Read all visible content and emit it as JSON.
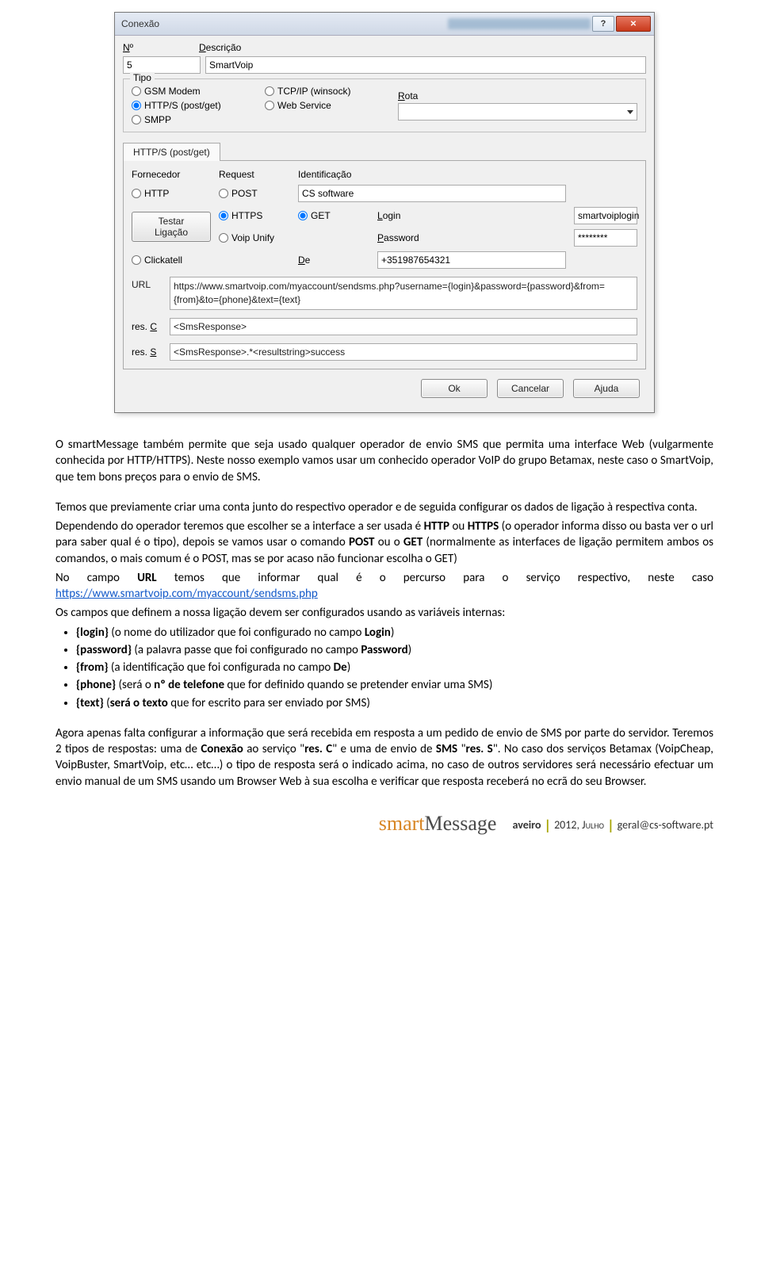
{
  "dialog": {
    "title": "Conexão",
    "header": {
      "num_label_u": "N",
      "num_label_rest": "º",
      "num_value": "5",
      "desc_label_u": "D",
      "desc_label_rest": "escrição",
      "desc_value": "SmartVoip"
    },
    "tipo": {
      "legend_u": "T",
      "legend_rest": "ipo",
      "radios": {
        "gsm": "GSM Modem",
        "https": "HTTP/S (post/get)",
        "smpp": "SMPP",
        "tcpip": "TCP/IP (winsock)",
        "webservice": "Web Service"
      },
      "rota_label_u": "R",
      "rota_label_rest": "ota"
    },
    "tab_label": "HTTP/S (post/get)",
    "http": {
      "fornecedor_label_u": "F",
      "fornecedor_label_rest": "ornecedor",
      "request_label_u": "R",
      "request_label_rest": "equest",
      "identificacao_label_u": "I",
      "identificacao_label_rest": "dentificação",
      "radios": {
        "http": "HTTP",
        "https": "HTTPS",
        "voip": "Voip Unify",
        "click": "Clickatell",
        "post": "POST",
        "get": "GET"
      },
      "ident_value": "CS software",
      "login_label_u": "L",
      "login_label_rest": "ogin",
      "login_value": "smartvoiplogin",
      "password_label_u": "P",
      "password_label_rest": "assword",
      "password_value": "********",
      "de_label_u": "D",
      "de_label_rest": "e",
      "de_value": "+351987654321",
      "test_label": "Testar\nLigação",
      "url_label_u": "U",
      "url_label_rest": "RL",
      "url_value": "https://www.smartvoip.com/myaccount/sendsms.php?username={login}&password={password}&from={from}&to={phone}&text={text}",
      "resc_label": "res. ",
      "resc_label_u": "C",
      "resc_value": "<SmsResponse>",
      "ress_label": "res. ",
      "ress_label_u": "S",
      "ress_value": "<SmsResponse>.*<resultstring>success"
    },
    "buttons": {
      "ok": "Ok",
      "cancel": "Cancelar",
      "help": "Ajuda"
    }
  },
  "doc": {
    "p1": "O smartMessage também permite que seja usado qualquer operador de envio SMS que permita uma interface Web (vulgarmente conhecida por HTTP/HTTPS). Neste nosso exemplo vamos usar um conhecido operador VoIP do grupo Betamax, neste caso o SmartVoip, que tem bons preços para o envio de SMS.",
    "p2": "Temos que previamente criar uma conta junto do respectivo operador e de seguida configurar os dados de ligação à respectiva conta.",
    "p3_a": "Dependendo do operador teremos que escolher se a interface a ser usada é ",
    "p3_b": " ou ",
    "p3_c": " (o operador informa disso ou basta ver o url para saber qual é o tipo), depois se vamos usar o comando ",
    "p3_d": " ou o ",
    "p3_e": " (normalmente as interfaces de ligação permitem ambos os comandos, o mais comum é o POST, mas se por acaso não funcionar escolha o GET)",
    "http": "HTTP",
    "https": "HTTPS",
    "post": "POST",
    "get": "GET",
    "p4_a": "No campo ",
    "url_b": "URL",
    "p4_b": " temos que informar qual é o percurso para o serviço respectivo, neste caso ",
    "url_link": "https://www.smartvoip.com/myaccount/sendsms.php",
    "p5": "Os campos que definem a nossa ligação devem ser configurados usando as variáveis internas:",
    "li1_a": "{login}",
    "li1_b": " (o nome do utilizador que foi configurado no campo ",
    "li1_c": "Login",
    "li1_d": ")",
    "li2_a": "{password}",
    "li2_b": " (a palavra passe que foi configurado no campo ",
    "li2_c": "Password",
    "li2_d": ")",
    "li3_a": "{from}",
    "li3_b": " (a identificação que foi configurada no campo ",
    "li3_c": "De",
    "li3_d": ")",
    "li4_a": "{phone}",
    "li4_b": " (será o ",
    "li4_c": "nº de telefone",
    "li4_d": " que for definido quando se pretender enviar uma SMS)",
    "li5_a": "{text}",
    "li5_b": " (",
    "li5_c": "será o texto",
    "li5_d": " que for escrito para ser enviado por SMS)",
    "p6_a": "Agora apenas falta configurar a informação que será recebida em resposta a um pedido de envio de SMS por parte do servidor. Teremos 2 tipos de respostas: uma de ",
    "p6_b": "Conexão",
    "p6_c": " ao serviço \"",
    "p6_d": "res. C",
    "p6_e": "\" e uma de envio de ",
    "p6_f": "SMS",
    "p6_g": " \"",
    "p6_h": "res. S",
    "p6_i": "\". No caso dos serviços Betamax (VoipCheap, VoipBuster, SmartVoip, etc… etc…) o tipo de resposta será o indicado acima, no caso de outros servidores será necessário efectuar um envio manual de um SMS usando um Browser Web à sua escolha e verificar que resposta receberá no ecrã do seu Browser."
  },
  "footer": {
    "logo_a": "smart",
    "logo_b": "Message",
    "city": "aveiro",
    "date": "2012, Julho",
    "email": "geral@cs-software.pt"
  }
}
